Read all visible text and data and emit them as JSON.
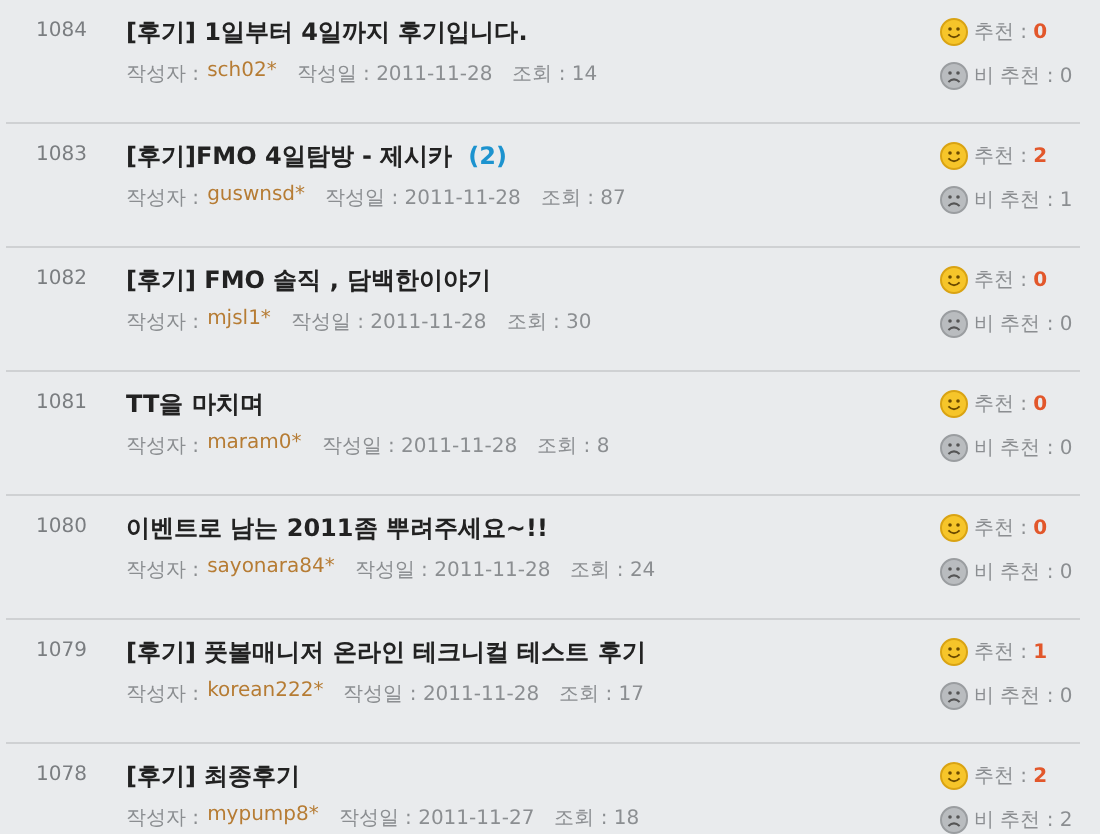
{
  "posts": [
    {
      "number": "1084",
      "title": "[후기] 1일부터 4일까지 후기입니다.",
      "author_label": "작성자 :",
      "author": "sch02*",
      "date": "작성일 : 2011-11-28",
      "views": "조회 : 14",
      "like_label": "추천 :",
      "likes": "0",
      "dislikes": "비 추천 : 0"
    },
    {
      "number": "1083",
      "title": "[후기]FMO 4일탐방 - 제시카",
      "comments": "(2)",
      "author_label": "작성자 :",
      "author": "guswnsd*",
      "date": "작성일 : 2011-11-28",
      "views": "조회 : 87",
      "like_label": "추천 :",
      "likes": "2",
      "dislikes": "비 추천 : 1"
    },
    {
      "number": "1082",
      "title": "[후기] FMO 솔직 , 담백한이야기",
      "author_label": "작성자 :",
      "author": "mjsl1*",
      "date": "작성일 : 2011-11-28",
      "views": "조회 : 30",
      "like_label": "추천 :",
      "likes": "0",
      "dislikes": "비 추천 : 0"
    },
    {
      "number": "1081",
      "title": "TT을 마치며",
      "author_label": "작성자 :",
      "author": "maram0*",
      "date": "작성일 : 2011-11-28",
      "views": "조회 : 8",
      "like_label": "추천 :",
      "likes": "0",
      "dislikes": "비 추천 : 0"
    },
    {
      "number": "1080",
      "title": "이벤트로 남는 2011좀 뿌려주세요~!!",
      "author_label": "작성자 :",
      "author": "sayonara84*",
      "date": "작성일 : 2011-11-28",
      "views": "조회 : 24",
      "like_label": "추천 :",
      "likes": "0",
      "dislikes": "비 추천 : 0"
    },
    {
      "number": "1079",
      "title": "[후기] 풋볼매니저 온라인 테크니컬 테스트 후기",
      "author_label": "작성자 :",
      "author": "korean222*",
      "date": "작성일 : 2011-11-28",
      "views": "조회 : 17",
      "like_label": "추천 :",
      "likes": "1",
      "dislikes": "비 추천 : 0"
    },
    {
      "number": "1078",
      "title": "[후기] 최종후기",
      "author_label": "작성자 :",
      "author": "mypump8*",
      "date": "작성일 : 2011-11-27",
      "views": "조회 : 18",
      "like_label": "추천 :",
      "likes": "2",
      "dislikes": "비 추천 : 2"
    }
  ]
}
